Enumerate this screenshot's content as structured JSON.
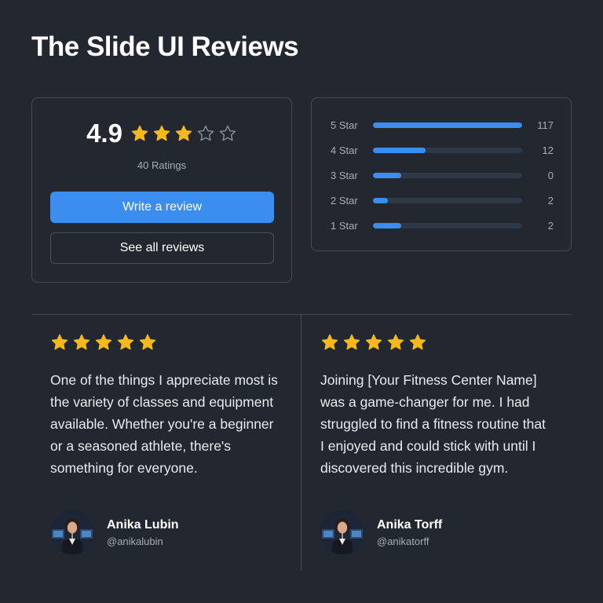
{
  "page": {
    "title": "The Slide UI Reviews"
  },
  "summary": {
    "rating": "4.9",
    "stars_filled": 3,
    "stars_total": 5,
    "ratings_count": "40 Ratings",
    "write_review_label": "Write a review",
    "see_all_label": "See all reviews"
  },
  "distribution": [
    {
      "label": "5 Star",
      "count": "117",
      "fill": 1.0
    },
    {
      "label": "4 Star",
      "count": "12",
      "fill": 0.35
    },
    {
      "label": "3 Star",
      "count": "0",
      "fill": 0.19
    },
    {
      "label": "2 Star",
      "count": "2",
      "fill": 0.1
    },
    {
      "label": "1 Star",
      "count": "2",
      "fill": 0.19
    }
  ],
  "reviews": [
    {
      "stars": 5,
      "text": "One of the things I appreciate most is the variety of classes and equipment available. Whether you're a beginner or a seasoned athlete, there's something for everyone.",
      "author_name": "Anika Lubin",
      "author_handle": "@anikalubin"
    },
    {
      "stars": 5,
      "text": "Joining [Your Fitness Center Name] was a game-changer for me. I had struggled to find a fitness routine that I enjoyed and could stick with until I discovered this incredible gym.",
      "author_name": "Anika Torff",
      "author_handle": "@anikatorff"
    }
  ],
  "colors": {
    "background": "#232830",
    "accent": "#3b8ef0",
    "star": "#f5b91e",
    "star_empty": "#8a919b",
    "border": "#444b55"
  },
  "icons": {
    "star_filled": "star-icon",
    "star_empty": "star-outline-icon",
    "avatar": "avatar"
  }
}
